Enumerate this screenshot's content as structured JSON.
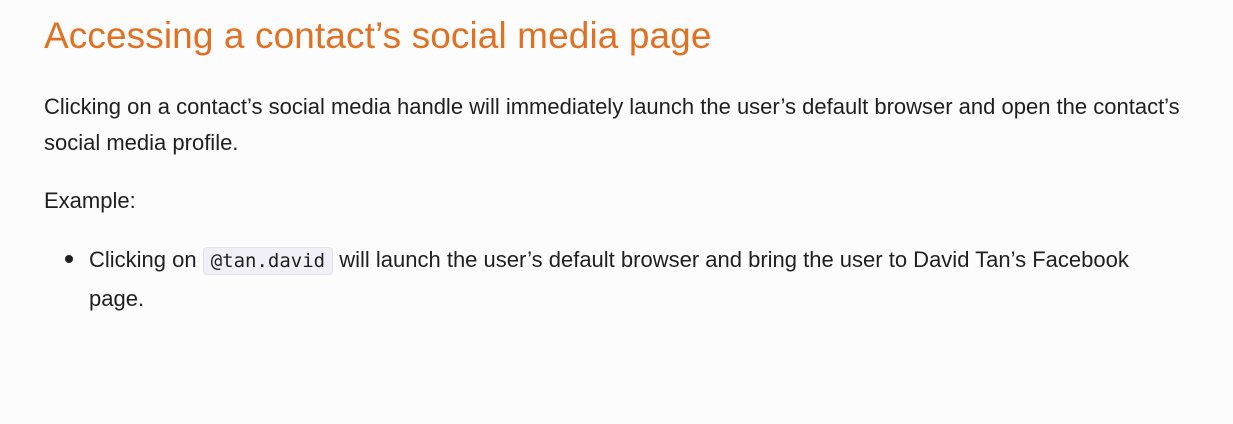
{
  "section": {
    "title": "Accessing a contact’s social media page",
    "intro": "Clicking on a contact’s social media handle will immediately launch the user’s default browser and open the contact’s social media profile.",
    "example_label": "Example:",
    "example": {
      "prefix": "Clicking on ",
      "code": "@tan.david",
      "suffix": " will launch the user’s default browser and bring the user to David Tan’s Facebook page."
    }
  }
}
